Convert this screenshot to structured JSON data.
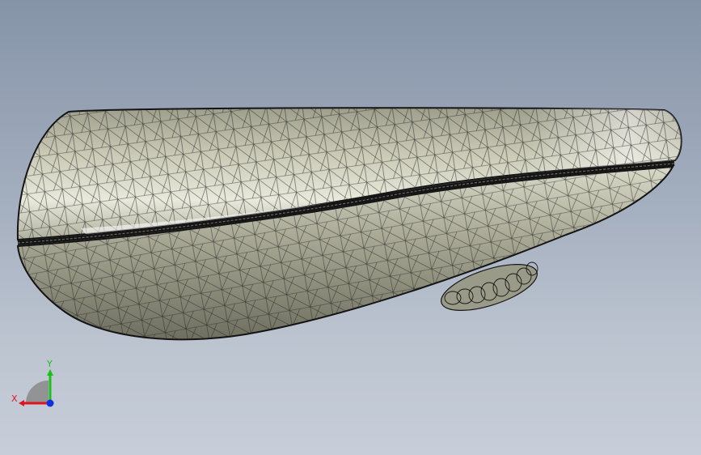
{
  "viewport": {
    "background_top": "#8694a8",
    "background_bottom": "#c7ceda",
    "model": {
      "display_mode": "wireframe-shaded",
      "body_color": "#c9c9b5",
      "edge_color": "#1e1e1e"
    }
  },
  "triad": {
    "x_label": "X",
    "y_label": "Y",
    "x_color": "#e0141e",
    "y_color": "#18c018",
    "z_color": "#1030e0"
  }
}
